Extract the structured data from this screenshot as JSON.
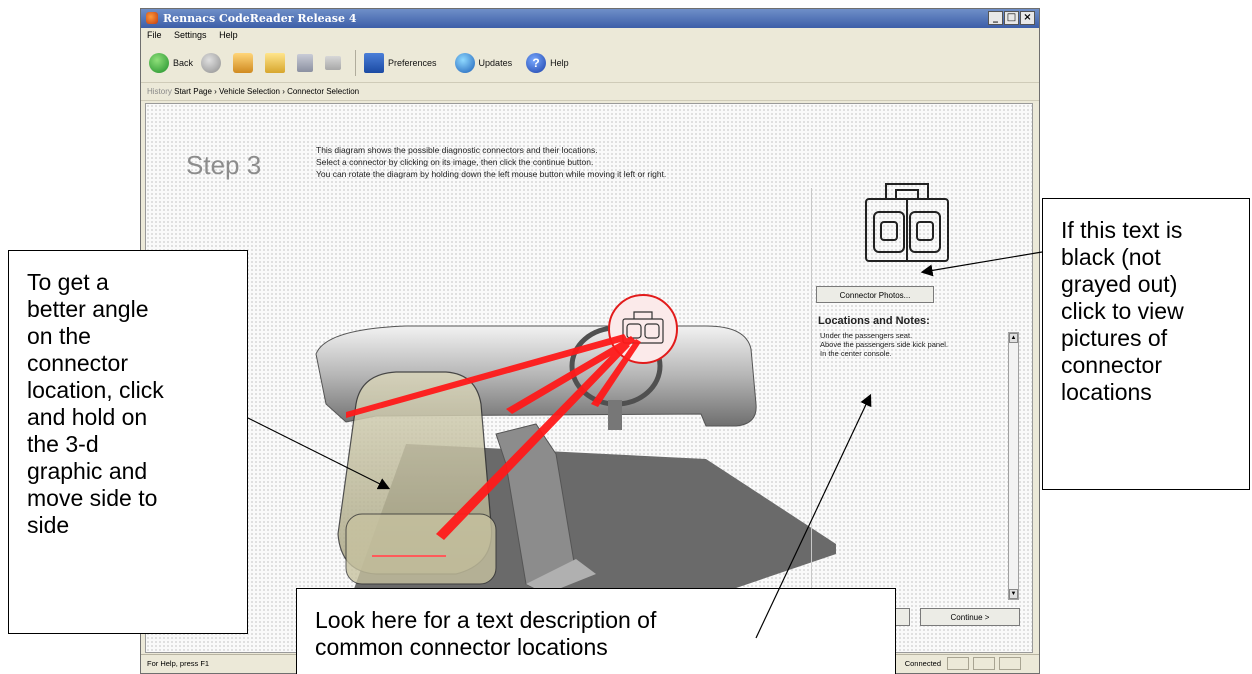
{
  "window": {
    "title": "Rennacs CodeReader Release 4",
    "controls": [
      "_",
      "□",
      "×"
    ]
  },
  "menu": [
    "File",
    "Settings",
    "Help"
  ],
  "toolbar": {
    "back": "Back",
    "preferences": "Preferences",
    "updates": "Updates",
    "help": "Help"
  },
  "history": {
    "label": "History",
    "path": "Start Page › Vehicle Selection › Connector Selection"
  },
  "main": {
    "step": "Step 3",
    "intro": [
      "This diagram shows the possible diagnostic connectors and their locations.",
      "Select a connector by clicking on its image, then click the continue button.",
      "You can rotate the diagram by holding down the left mouse button while moving it left or right."
    ],
    "photos_button": "Connector Photos...",
    "locations_heading": "Locations and Notes:",
    "notes": [
      "Under the passengers seat.",
      "Above the passengers side kick panel.",
      "In the center console."
    ],
    "continue_button": "Continue >"
  },
  "status": {
    "help_text": "For Help, press F1",
    "connection": "Connected"
  },
  "callouts": {
    "left": [
      "To get a",
      "better angle",
      "on the",
      "connector",
      "location, click",
      "and hold on",
      "the 3-d",
      "graphic and",
      "move side to",
      "side"
    ],
    "right": [
      "If this text is",
      "black (not",
      "grayed out)",
      "click to view",
      "pictures of",
      "connector",
      "locations"
    ],
    "bottom": [
      "Look here for a text description of",
      "common connector locations"
    ]
  },
  "colors": {
    "titlebar": "#3c5ea8",
    "highlight_red": "#ff1a1a",
    "step_gray": "#8c8c8c"
  }
}
